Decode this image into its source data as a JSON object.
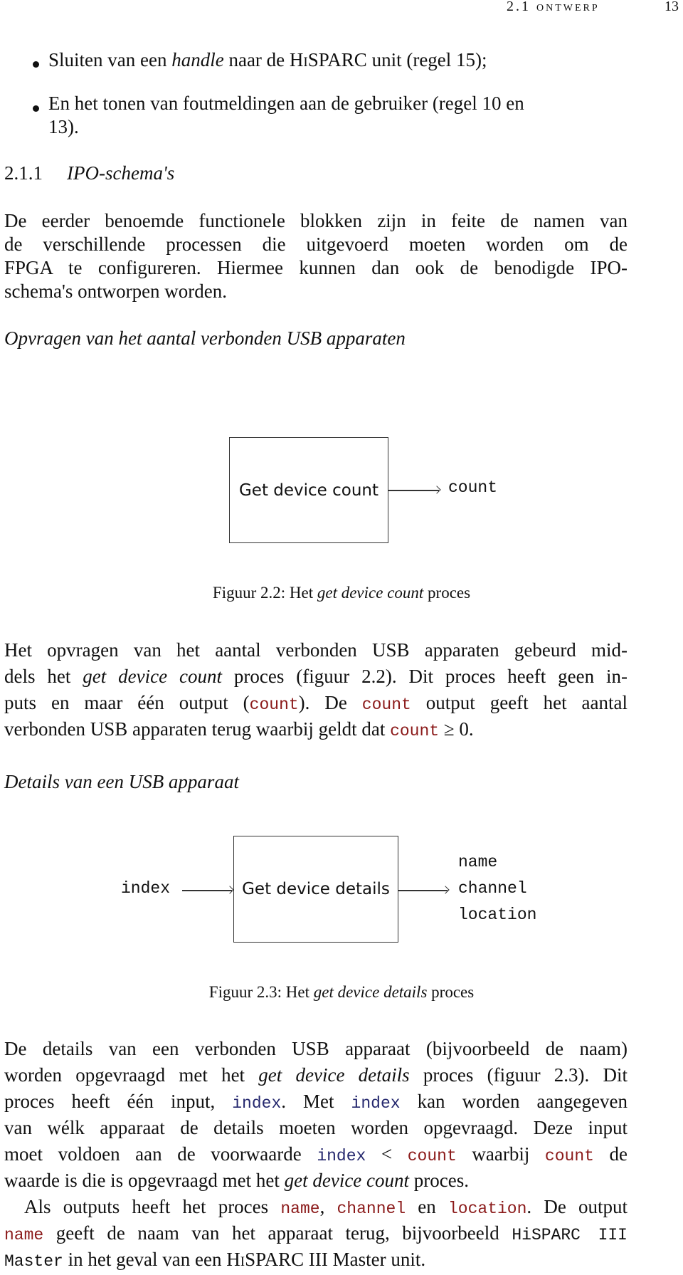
{
  "header": {
    "section": "2.1 ontwerp",
    "page_number": "13"
  },
  "bullets": [
    {
      "parts": [
        "Sluiten van een ",
        "handle",
        " naar de ",
        "HiSPARC",
        " unit (regel 15);"
      ]
    },
    {
      "line1": "En het tonen van foutmeldingen aan de gebruiker (regel 10 en",
      "line2": "13)."
    }
  ],
  "subsection": {
    "number": "2.1.1",
    "title": "IPO-schema's"
  },
  "intro_paragraph": [
    "De eerder benoemde functionele blokken zijn in feite de namen van",
    "de verschillende processen die uitgevoerd moeten worden om de",
    "FPGA te configureren. Hiermee kunnen dan ook de benodigde IPO-",
    "schema's ontworpen worden."
  ],
  "figure1": {
    "heading": "Opvragen van het aantal verbonden USB apparaten",
    "process": "Get device count",
    "outputs": [
      "count"
    ],
    "caption_prefix": "Figuur 2.2: Het ",
    "caption_italic": "get device count",
    "caption_suffix": " proces"
  },
  "para2": {
    "l1": "Het opvragen van het aantal verbonden USB apparaten gebeurd mid-",
    "l2a": "dels het ",
    "l2i": "get device count",
    "l2b": " proces (figuur 2.2). Dit proces heeft geen in-",
    "l3a": "puts en maar één output (",
    "l3c": "count",
    "l3b": "). De ",
    "l3d": "count",
    "l3e": " output geeft het aantal",
    "l4a": "verbonden USB apparaten terug waarbij geldt dat ",
    "l4c": "count",
    "l4b": " ≥ 0."
  },
  "figure2": {
    "heading": "Details van een USB apparaat",
    "inputs": [
      "index"
    ],
    "process": "Get device details",
    "outputs": [
      "name",
      "channel",
      "location"
    ],
    "caption_prefix": "Figuur 2.3: Het ",
    "caption_italic": "get device details",
    "caption_suffix": " proces"
  },
  "para3": {
    "l1": "De details van een verbonden USB apparaat (bijvoorbeeld de naam)",
    "l2a": "worden opgevraagd met het ",
    "l2i": "get device details",
    "l2b": " proces (figuur 2.3). Dit",
    "l3a": "proces heeft één input, ",
    "l3c": "index",
    "l3b": ". Met ",
    "l3d": "index",
    "l3e": " kan worden aangegeven",
    "l4": "van wélk apparaat de details moeten worden opgevraagd. Deze input",
    "l5a": "moet voldoen aan de voorwaarde ",
    "l5c": "index",
    "l5b": " < ",
    "l5d": "count",
    "l5e": " waarbij ",
    "l5f": "count",
    "l5g": " de",
    "l6a": "waarde is die is opgevraagd met het ",
    "l6i": "get device count",
    "l6b": " proces."
  },
  "para4": {
    "l1a": "Als outputs heeft het proces ",
    "l1c": "name",
    "l1b": ", ",
    "l1d": "channel",
    "l1e": " en ",
    "l1f": "location",
    "l1g": ". De output",
    "l2c": "name",
    "l2a": " geeft de naam van het apparaat terug, bijvoorbeeld ",
    "l2d": "HiSPARC III",
    "l3c": "Master",
    "l3a": " in het geval van een ",
    "l3s": "HiSPARC III",
    "l3b": " Master unit."
  },
  "colors": {
    "code_output": "#8b1a1a",
    "code_input": "#25286e"
  }
}
